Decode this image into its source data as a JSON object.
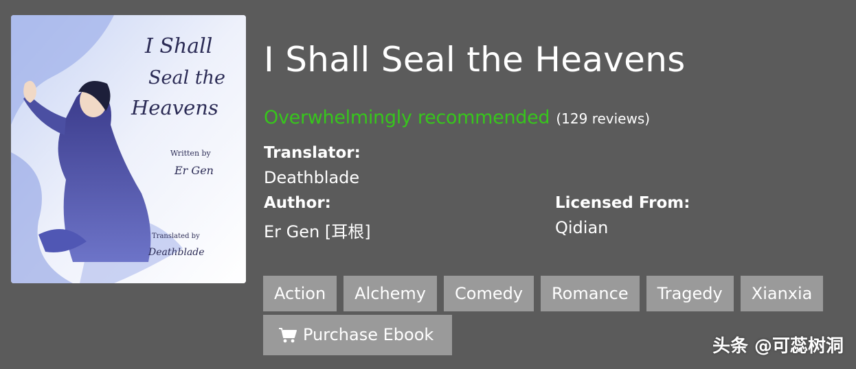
{
  "book": {
    "title": "I Shall Seal the Heavens",
    "rating": "Overwhelmingly recommended",
    "reviews": "(129 reviews)",
    "translator_label": "Translator:",
    "translator": "Deathblade",
    "author_label": "Author:",
    "author": "Er Gen [耳根]",
    "licensed_label": "Licensed From:",
    "licensed": "Qidian"
  },
  "cover": {
    "title_lines": [
      "I Shall",
      "Seal the",
      "Heavens"
    ],
    "written_by": "Written by",
    "author": "Er Gen",
    "translated_by": "Translated by",
    "translator": "Deathblade"
  },
  "tags": [
    "Action",
    "Alchemy",
    "Comedy",
    "Romance",
    "Tragedy",
    "Xianxia"
  ],
  "purchase": {
    "label": "Purchase Ebook",
    "icon": "shopping-cart-icon"
  },
  "watermark": "头条 @可蕊树洞",
  "colors": {
    "rating": "#37c61c",
    "tag_bg": "#9a9a9a",
    "page_bg": "#5b5b5b"
  }
}
